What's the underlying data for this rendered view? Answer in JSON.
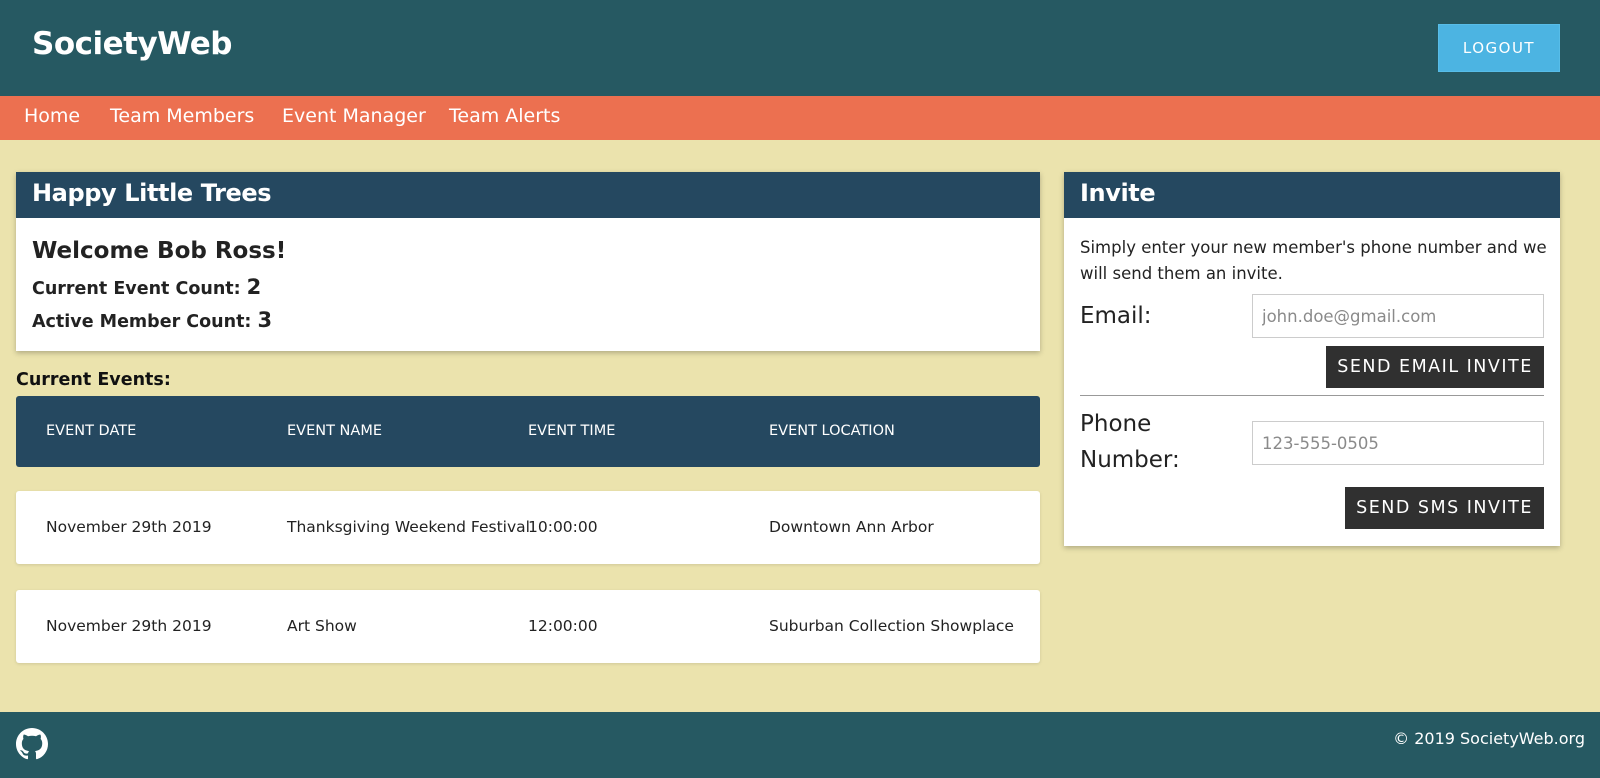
{
  "app": {
    "title": "SocietyWeb",
    "logout_label": "LOGOUT"
  },
  "nav": {
    "items": [
      {
        "label": "Home"
      },
      {
        "label": "Team Members"
      },
      {
        "label": "Event Manager"
      },
      {
        "label": "Team Alerts"
      }
    ]
  },
  "summary": {
    "society_name": "Happy Little Trees",
    "welcome": "Welcome Bob Ross!",
    "event_count_label": "Current Event Count:",
    "event_count": "2",
    "member_count_label": "Active Member Count:",
    "member_count": "3"
  },
  "events": {
    "section_title": "Current Events:",
    "columns": [
      "EVENT DATE",
      "EVENT NAME",
      "EVENT TIME",
      "EVENT LOCATION"
    ],
    "rows": [
      [
        "November 29th 2019",
        "Thanksgiving Weekend Festival",
        "10:00:00",
        "Downtown Ann Arbor"
      ],
      [
        "November 29th 2019",
        "Art Show",
        "12:00:00",
        "Suburban Collection Showplace"
      ]
    ]
  },
  "invite": {
    "title": "Invite",
    "description": "Simply enter your new member's phone number and we will send them an invite.",
    "email_label": "Email:",
    "email_placeholder": "john.doe@gmail.com",
    "email_button": "SEND EMAIL INVITE",
    "phone_label": "Phone Number:",
    "phone_placeholder": "123-555-0505",
    "sms_button": "SEND SMS INVITE"
  },
  "footer": {
    "icon": "github-icon",
    "copyright": "© 2019 SocietyWeb.org"
  },
  "colors": {
    "header": "#265962",
    "nav": "#ec7050",
    "background": "#ebe3ad",
    "card_header": "#254860",
    "logout": "#4cb4e2",
    "dark_button": "#303030"
  }
}
